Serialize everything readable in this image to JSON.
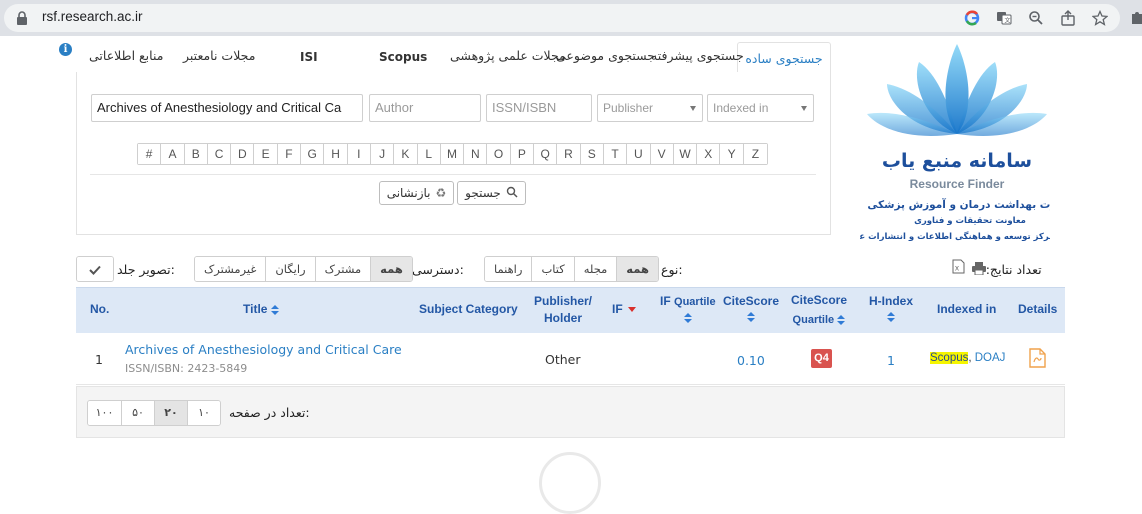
{
  "browser": {
    "url": "rsf.research.ac.ir"
  },
  "tabs": {
    "simple": "جستجوی ساده",
    "advanced": "جستجوی پیشرفته",
    "topical": "جستجوی موضوعی",
    "journals": "مجلات علمی پژوهشی",
    "scopus": "Scopus",
    "isi": "ISI",
    "invalid": "مجلات نامعتبر",
    "sources": "منابع اطلاعاتی"
  },
  "search": {
    "title_value": "Archives of Anesthesiology and Critical Ca",
    "author_placeholder": "Author",
    "issn_placeholder": "ISSN/ISBN",
    "publisher_placeholder": "Publisher",
    "indexed_placeholder": "Indexed in",
    "letters": [
      "#",
      "A",
      "B",
      "C",
      "D",
      "E",
      "F",
      "G",
      "H",
      "I",
      "J",
      "K",
      "L",
      "M",
      "N",
      "O",
      "P",
      "Q",
      "R",
      "S",
      "T",
      "U",
      "V",
      "W",
      "X",
      "Y",
      "Z"
    ],
    "search_label": "جستجو",
    "reset_label": "بازنشانی"
  },
  "logo": {
    "title_fa": "سامانه منبع یاب",
    "title_en": "Resource Finder",
    "line1": "وزارت بهداشت درمان و آموزش پزشکی",
    "line2": "معاونت تحقیقات و فناوری",
    "line3": "مرکز توسعه و هماهنگی اطلاعات و انتشارات علمی",
    "colors": {
      "blue_light": "#7fd0f5",
      "blue_dark": "#1565c0",
      "text_blue": "#1d4f9c"
    }
  },
  "toolbar": {
    "results_label": "تعداد نتایج: ۱",
    "type_label": "نوع:",
    "type_options": [
      "همه",
      "مجله",
      "کتاب",
      "راهنما"
    ],
    "access_label": "دسترسی:",
    "access_options": [
      "همه",
      "مشترک",
      "رایگان",
      "غیرمشترک"
    ],
    "cover_label": "تصویر جلد:"
  },
  "table": {
    "headers": {
      "no": "No.",
      "title": "Title",
      "subject": "Subject Category",
      "publisher_1": "Publisher/",
      "publisher_2": "Holder",
      "if": "IF",
      "if_q_1": "IF",
      "if_q_2": "Quartile",
      "citescore": "CiteScore",
      "cs_q_1": "CiteScore",
      "cs_q_2": "Quartile",
      "hindex": "H-Index",
      "indexed": "Indexed in",
      "details": "Details"
    },
    "rows": [
      {
        "no": "1",
        "title": "Archives of Anesthesiology and Critical Care",
        "issn": "ISSN/ISBN: 2423-5849",
        "publisher": "Other",
        "citescore": "0.10",
        "cs_quartile": "Q4",
        "hindex": "1",
        "indexed_scopus": "Scopus",
        "indexed_sep": ", ",
        "indexed_doaj": "DOAJ"
      }
    ]
  },
  "pager": {
    "label": "تعداد در صفحه:",
    "options": [
      "۱۰۰",
      "۵۰",
      "۲۰",
      "۱۰"
    ],
    "selected": "۲۰"
  }
}
